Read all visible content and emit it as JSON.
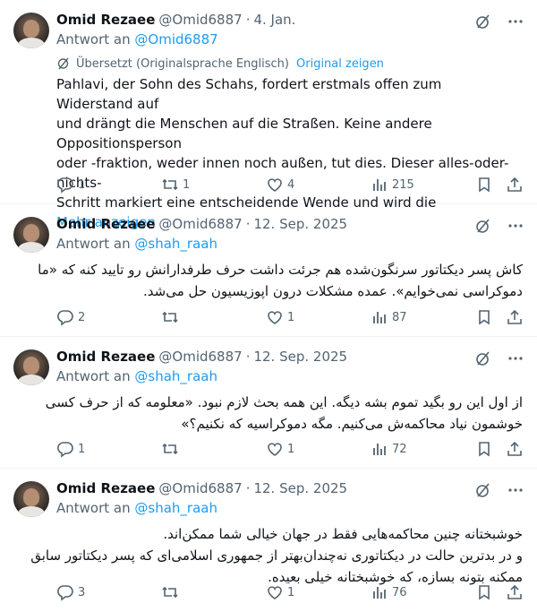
{
  "tweets": [
    {
      "author_name": "Omid Rezaee",
      "handle": "@Omid6887",
      "dot": "·",
      "date": "4. Jan.",
      "reply_prefix": "Antwort an",
      "reply_to": "@Omid6887",
      "translated_label": "Übersetzt (Originalsprache Englisch)",
      "show_original": "Original zeigen",
      "text_lines": [
        "Pahlavi, der Sohn des Schahs, fordert erstmals offen zum Widerstand auf",
        "und drängt die Menschen auf die Straßen. Keine andere Oppositionsperson",
        "oder -fraktion, weder innen noch außen, tut dies. Dieser alles-oder-nichts-",
        "Schritt markiert eine entscheidende Wende und wird die"
      ],
      "more": "Mehr anzeigen",
      "replies": "1",
      "reposts": "1",
      "likes": "4",
      "views": "215"
    },
    {
      "author_name": "Omid Rezaee",
      "handle": "@Omid6887",
      "dot": "·",
      "date": "12. Sep. 2025",
      "reply_prefix": "Antwort an",
      "reply_to": "@shah_raah",
      "text_lines": [
        "کاش پسر دیکتاتور سرنگون‌شده هم جرئت داشت حرف طرفدارانش رو تایید کنه که «ما",
        "دموکراسی نمی‌خوایم». عمده مشکلات درون اپوزیسیون حل می‌شد."
      ],
      "replies": "2",
      "reposts": "",
      "likes": "1",
      "views": "87"
    },
    {
      "author_name": "Omid Rezaee",
      "handle": "@Omid6887",
      "dot": "·",
      "date": "12. Sep. 2025",
      "reply_prefix": "Antwort an",
      "reply_to": "@shah_raah",
      "text_lines": [
        "از اول این رو بگید تموم بشه دیگه. این همه بحث لازم نبود. «معلومه که از حرف کسی",
        "خوشمون نیاد محاکمه‌ش می‌کنیم. مگه دموکراسیه که نکنیم؟»"
      ],
      "replies": "1",
      "reposts": "",
      "likes": "1",
      "views": "72"
    },
    {
      "author_name": "Omid Rezaee",
      "handle": "@Omid6887",
      "dot": "·",
      "date": "12. Sep. 2025",
      "reply_prefix": "Antwort an",
      "reply_to": "@shah_raah",
      "text_lines": [
        "خوشبختانه چنین محاکمه‌هایی فقط در جهان خیالی شما ممکن‌اند.",
        "و در بدترین حالت در دیکتاتوری نه‌چندان‌بهتر از جمهوری اسلامی‌ای که پسر دیکتاتور سابق",
        "ممکنه بتونه بسازه، که خوشبختانه خیلی بعیده."
      ],
      "replies": "3",
      "reposts": "",
      "likes": "1",
      "views": "76"
    }
  ],
  "icons": {
    "reply": "reply-icon",
    "repost": "repost-icon",
    "like": "like-icon",
    "views": "views-icon",
    "bookmark": "bookmark-icon",
    "share": "share-icon",
    "grok": "grok-icon",
    "more": "more-icon",
    "translate": "translate-icon"
  },
  "colors": {
    "link": "#1d9bf0",
    "secondary": "#536471",
    "text": "#0f1419",
    "divider": "#eff3f4"
  }
}
